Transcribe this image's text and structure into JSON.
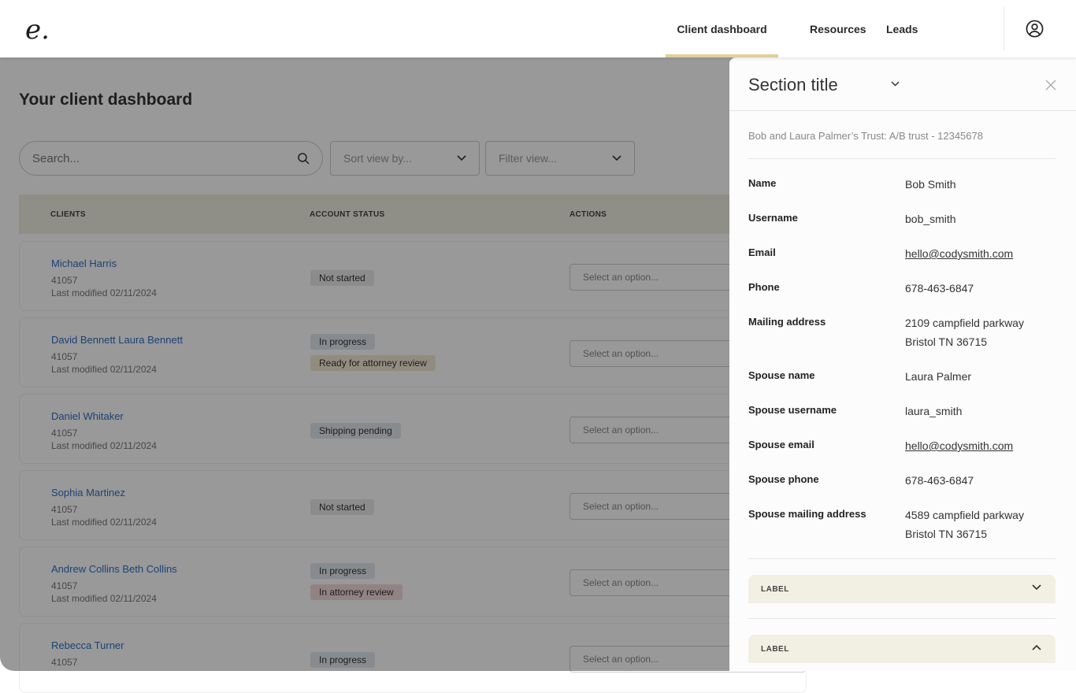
{
  "header": {
    "logo": "e.",
    "nav": [
      {
        "label": "Client dashboard",
        "active": true
      },
      {
        "label": "Resources"
      },
      {
        "label": "Leads"
      }
    ]
  },
  "main": {
    "title": "Your client dashboard",
    "search_placeholder": "Search...",
    "sort_placeholder": "Sort view by...",
    "filter_placeholder": "Filter view...",
    "columns": [
      "CLIENTS",
      "ACCOUNT STATUS",
      "ACTIONS"
    ],
    "rows": [
      {
        "name": "Michael Harris",
        "id": "41057",
        "modified": "Last modified 02/11/2024",
        "statuses": [
          {
            "label": "Not started",
            "color": "#e9e9e9"
          }
        ],
        "action": "Select an option..."
      },
      {
        "name": "David Bennett  Laura Bennett",
        "id": "41057",
        "modified": "Last modified 02/11/2024",
        "statuses": [
          {
            "label": "In progress",
            "color": "#dfe8ef"
          },
          {
            "label": "Ready for attorney review",
            "color": "#f4e9d4"
          }
        ],
        "action": "Select an option..."
      },
      {
        "name": "Daniel Whitaker",
        "id": "41057",
        "modified": "Last modified 02/11/2024",
        "statuses": [
          {
            "label": "Shipping pending",
            "color": "#dfe8ef"
          }
        ],
        "action": "Select an option..."
      },
      {
        "name": "Sophia Martinez",
        "id": "41057",
        "modified": "Last modified 02/11/2024",
        "statuses": [
          {
            "label": "Not started",
            "color": "#e9e9e9"
          }
        ],
        "action": "Select an option..."
      },
      {
        "name": "Andrew Collins  Beth Collins",
        "id": "41057",
        "modified": "Last modified 02/11/2024",
        "statuses": [
          {
            "label": "In progress",
            "color": "#dfe8ef"
          },
          {
            "label": "In attorney review",
            "color": "#f3dada"
          }
        ],
        "action": "Select an option..."
      },
      {
        "name": "Rebecca Turner",
        "id": "41057",
        "modified": "",
        "statuses": [
          {
            "label": "In progress",
            "color": "#dfe8ef"
          }
        ],
        "action": "Select an option..."
      }
    ]
  },
  "panel": {
    "title": "Section title",
    "subtitle": "Bob and Laura Palmer’s Trust: A/B trust - 12345678",
    "fields": [
      {
        "label": "Name",
        "value": [
          "Bob Smith"
        ]
      },
      {
        "label": "Username",
        "value": [
          "bob_smith"
        ]
      },
      {
        "label": "Email",
        "value": [
          "hello@codysmith.com"
        ],
        "link": true
      },
      {
        "label": "Phone",
        "value": [
          "678-463-6847"
        ]
      },
      {
        "label": "Mailing address",
        "value": [
          "2109 campfield parkway",
          "Bristol TN 36715"
        ]
      },
      {
        "label": "Spouse name",
        "value": [
          "Laura Palmer"
        ]
      },
      {
        "label": "Spouse username",
        "value": [
          "laura_smith"
        ]
      },
      {
        "label": "Spouse email",
        "value": [
          "hello@codysmith.com"
        ],
        "link": true
      },
      {
        "label": "Spouse phone",
        "value": [
          "678-463-6847"
        ]
      },
      {
        "label": "Spouse mailing address",
        "value": [
          "4589 campfield parkway",
          "Bristol TN 36715"
        ]
      }
    ],
    "accordions": [
      {
        "label": "LABEL",
        "expanded": false
      },
      {
        "label": "LABEL",
        "expanded": true
      }
    ]
  }
}
